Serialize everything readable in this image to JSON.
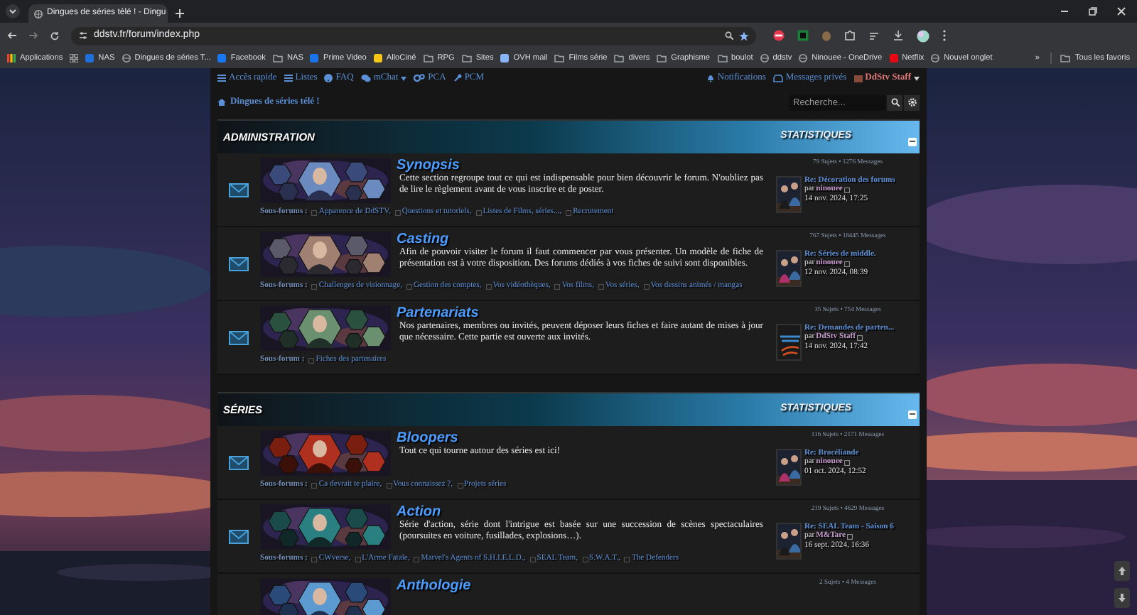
{
  "browser": {
    "tab_title": "Dingues de séries télé ! - Dingu",
    "url": "ddstv.fr/forum/index.php",
    "bookmarks": [
      {
        "label": "Applications",
        "kind": "apps"
      },
      {
        "label": "NAS",
        "kind": "site",
        "color": "#1e6fd9"
      },
      {
        "label": "Dingues de séries T...",
        "kind": "globe"
      },
      {
        "label": "Facebook",
        "kind": "site",
        "color": "#1877f2"
      },
      {
        "label": "NAS",
        "kind": "folder"
      },
      {
        "label": "Prime Video",
        "kind": "site",
        "color": "#1a73e8"
      },
      {
        "label": "AlloCiné",
        "kind": "site",
        "color": "#f5c518"
      },
      {
        "label": "RPG",
        "kind": "folder"
      },
      {
        "label": "Sites",
        "kind": "folder"
      },
      {
        "label": "OVH mail",
        "kind": "site",
        "color": "#8ab4f8"
      },
      {
        "label": "Films série",
        "kind": "folder"
      },
      {
        "label": "divers",
        "kind": "folder"
      },
      {
        "label": "Graphisme",
        "kind": "folder"
      },
      {
        "label": "boulot",
        "kind": "folder"
      },
      {
        "label": "ddstv",
        "kind": "globe"
      },
      {
        "label": "Ninouee - OneDrive",
        "kind": "globe"
      },
      {
        "label": "Netflix",
        "kind": "site",
        "color": "#e50914"
      },
      {
        "label": "Nouvel onglet",
        "kind": "globe"
      }
    ],
    "more_bookmarks": "»",
    "all_bookmarks": "Tous les favoris"
  },
  "nav": {
    "left": [
      {
        "label": "Accès rapide"
      },
      {
        "label": "Listes"
      },
      {
        "label": "FAQ"
      },
      {
        "label": "mChat",
        "dropdown": true
      },
      {
        "label": "PCA"
      },
      {
        "label": "PCM"
      }
    ],
    "right": [
      {
        "label": "Notifications"
      },
      {
        "label": "Messages privés"
      }
    ],
    "user": "DdStv Staff"
  },
  "breadcrumb": "Dingues de séries télé !",
  "search": {
    "placeholder": "Recherche..."
  },
  "categories": [
    {
      "title": "ADMINISTRATION",
      "stats_label": "STATISTIQUES",
      "forums": [
        {
          "name": "Synopsis",
          "description": "Cette section regroupe tout ce qui est indispensable pour bien découvrir le forum. N'oubliez pas de lire le règlement avant de vous inscrire et de poster.",
          "subforums_label": "Sous-forums :",
          "subforums": [
            "Apparence de DdSTV,",
            "Questions et tutoriels,",
            "Listes de Films, séries...,",
            "Recrutement"
          ],
          "stats": "79 Sujets • 1276 Messages",
          "last_post": {
            "kind": "picture",
            "title": "Re: Décoration des forums",
            "by": "par",
            "author": "ninouee",
            "date": "14 nov. 2024, 17:25"
          }
        },
        {
          "name": "Casting",
          "description": "Afin de pouvoir visiter le forum il faut commencer par vous présenter. Un modèle de fiche de présentation est à votre disposition. Des forums dédiés à vos fiches de suivi sont disponibles.",
          "subforums_label": "Sous-forums :",
          "subforums": [
            "Challenges de visionnage,",
            "Gestion des comptes,",
            "Vos vidéothèques,",
            "Vos films,",
            "Vos séries,",
            "Vos dessins animés / mangas"
          ],
          "stats": "767 Sujets • 18445 Messages",
          "last_post": {
            "kind": "picture",
            "title": "Re: Séries de middle.",
            "by": "par",
            "author": "ninouee",
            "date": "12 nov. 2024, 08:39"
          }
        },
        {
          "name": "Partenariats",
          "description": "Nos partenaires, membres ou invités, peuvent déposer leurs fiches et faire autant de mises à jour que nécessaire. Cette partie est ouverte aux invités.",
          "subforums_label": "Sous-forum :",
          "subforums": [
            "Fiches des partenaires"
          ],
          "stats": "35 Sujets • 754 Messages",
          "last_post": {
            "kind": "logo",
            "title": "Re: Demandes de parten...",
            "by": "par",
            "author": "DdStv Staff",
            "date": "14 nov. 2024, 17:42"
          }
        }
      ]
    },
    {
      "title": "SÉRIES",
      "stats_label": "STATISTIQUES",
      "forums": [
        {
          "name": "Bloopers",
          "description": "Tout ce qui tourne autour des séries est ici!",
          "subforums_label": "Sous-forums :",
          "subforums": [
            "Ca devrait te plaire,",
            "Vous connaissez ?,",
            "Projets séries"
          ],
          "stats": "116 Sujets • 2171 Messages",
          "last_post": {
            "kind": "picture",
            "title": "Re: Brocéliande",
            "by": "par",
            "author": "ninouee",
            "date": "01 oct. 2024, 12:52"
          }
        },
        {
          "name": "Action",
          "description": "Série d'action, série dont l'intrigue est basée sur une succession de scènes spectaculaires (poursuites en voiture, fusillades, explosions…).",
          "subforums_label": "Sous-forums :",
          "subforums": [
            "CWverse,",
            "L'Arme Fatale,",
            "Marvel's Agents of S.H.I.E.L.D.,",
            "SEAL Team,",
            "S.W.A.T.,",
            "The Defenders"
          ],
          "stats": "219 Sujets • 4629 Messages",
          "last_post": {
            "kind": "picture",
            "title": "Re: SEAL Team - Saison 6",
            "by": "par",
            "author": "M&Tare",
            "date": "16 sept. 2024, 16:36"
          }
        },
        {
          "name": "Anthologie",
          "stats": "2 Sujets • 4 Messages"
        }
      ]
    }
  ]
}
